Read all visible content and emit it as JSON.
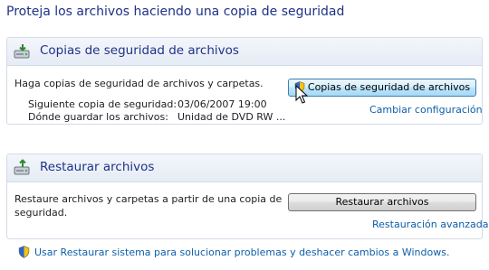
{
  "page": {
    "title": "Proteja los archivos haciendo una copia de seguridad"
  },
  "backup": {
    "header": "Copias de seguridad de archivos",
    "description": "Haga copias de seguridad de archivos y carpetas.",
    "next_backup_label": "Siguiente copia de seguridad:",
    "next_backup_value": "03/06/2007 19:00",
    "location_label": "Dónde guardar los archivos:",
    "location_value": "Unidad de DVD RW ...",
    "button_label": "Copias de seguridad de archivos",
    "change_link": "Cambiar configuración"
  },
  "restore": {
    "header": "Restaurar archivos",
    "description_line1": "Restaure archivos y carpetas a partir de una copia de",
    "description_line2": "seguridad.",
    "button_label": "Restaurar archivos",
    "advanced_link": "Restauración avanzada"
  },
  "system_restore": {
    "link": "Usar Restaurar sistema para solucionar problemas y deshacer cambios a Windows."
  },
  "colors": {
    "title": "#1e3287",
    "link": "#0d5ea8",
    "panel_border": "#d3dbe6",
    "header_bg": "#e6ecf5"
  },
  "icons": {
    "backup": "backup-drive-icon",
    "restore": "restore-drive-icon",
    "shield": "uac-shield-icon",
    "cursor": "mouse-pointer-icon"
  }
}
